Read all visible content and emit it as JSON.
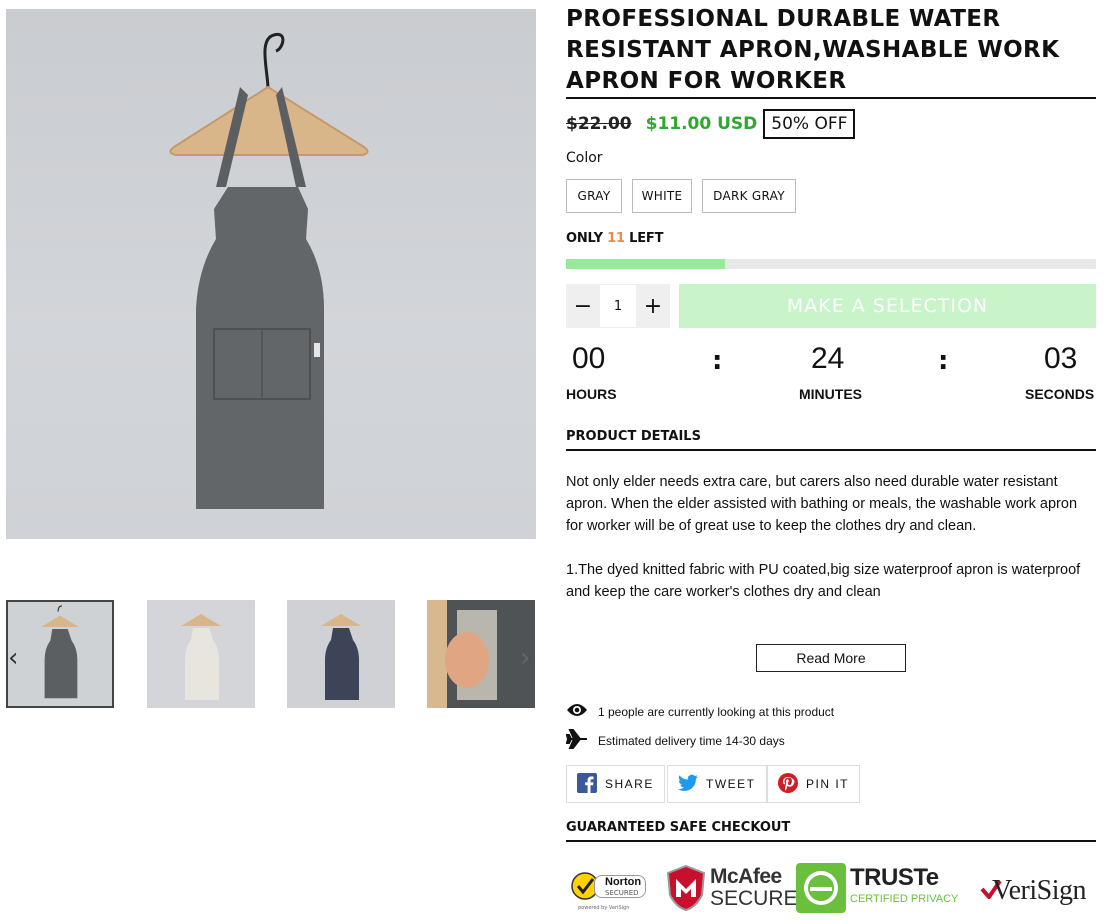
{
  "product": {
    "title": "PROFESSIONAL DURABLE WATER RESISTANT APRON,WASHABLE WORK APRON FOR WORKER",
    "old_price": "$22.00",
    "new_price": "$11.00 USD",
    "discount": "50% OFF",
    "color_label": "Color",
    "colors": [
      "GRAY",
      "WHITE",
      "DARK GRAY"
    ]
  },
  "stock": {
    "prefix": "ONLY",
    "count": "11",
    "suffix": "LEFT",
    "level_fraction": 0.3
  },
  "purchase": {
    "quantity": "1",
    "minus": "−",
    "plus": "+",
    "cta": "MAKE A SELECTION"
  },
  "countdown": {
    "hours": "00",
    "minutes": "24",
    "seconds": "03",
    "hours_label": "HOURS",
    "minutes_label": "MINUTES",
    "seconds_label": "SECONDS",
    "separator": ":"
  },
  "details": {
    "heading": "PRODUCT DETAILS",
    "paragraph_1": "Not only elder needs extra care, but carers also need durable water resistant apron. When the elder assisted with bathing or meals, the washable work apron for worker will be of great use to keep the clothes dry and clean.",
    "paragraph_2": "1.The dyed knitted fabric with PU coated,big size waterproof apron is waterproof and keep the care worker's clothes dry and clean",
    "read_more": "Read More"
  },
  "info": {
    "viewers": "1 people are currently looking at this product",
    "delivery": "Estimated delivery time 14-30 days"
  },
  "share": {
    "facebook": "SHARE",
    "twitter": "TWEET",
    "pinterest": "PIN IT"
  },
  "checkout": {
    "heading": "GUARANTEED SAFE CHECKOUT",
    "norton_top": "Norton",
    "norton_sub": "SECURED",
    "norton_powered": "powered by VeriSign",
    "mcafee_top": "McAfee",
    "mcafee_sub": "SECURE",
    "truste_top": "TRUSTe",
    "truste_sub": "CERTIFIED PRIVACY",
    "verisign": "VeriSign"
  },
  "colors": {
    "sale_green": "#2fa82c",
    "stock_orange": "#f08a3c",
    "bar_fill": "#9ae99a",
    "cta_bg": "#c9f4c9"
  }
}
